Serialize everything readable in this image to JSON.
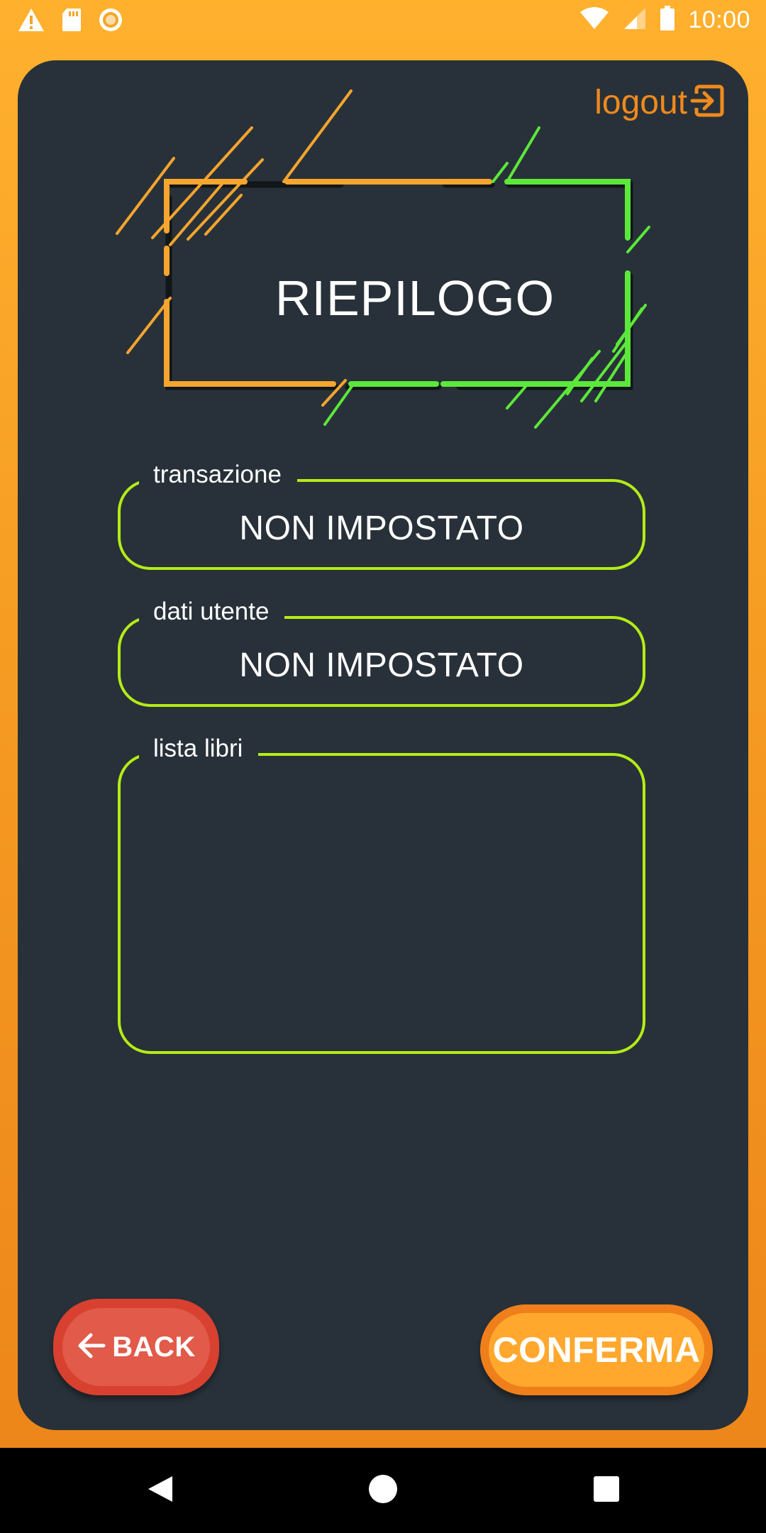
{
  "status_bar": {
    "time": "10:00",
    "icons": [
      "warning-icon",
      "sd-card-icon",
      "sync-icon",
      "wifi-icon",
      "signal-icon",
      "battery-icon"
    ]
  },
  "header": {
    "logout_label": "logout",
    "logout_icon": "logout-icon"
  },
  "title": "RIEPILOGO",
  "fields": {
    "transazione": {
      "label": "transazione",
      "value": "NON IMPOSTATO"
    },
    "dati_utente": {
      "label": "dati utente",
      "value": "NON IMPOSTATO"
    },
    "lista_libri": {
      "label": "lista libri",
      "value": ""
    }
  },
  "buttons": {
    "back_label": "BACK",
    "confirm_label": "CONFERMA"
  },
  "colors": {
    "background_top": "#ffb12e",
    "background_bottom": "#ec8419",
    "card": "#283139",
    "accent_orange": "#f08a1c",
    "accent_lime": "#b4ec16",
    "accent_green": "#5ce83a",
    "back_red": "#d84030",
    "confirm_orange": "#ffa82d"
  }
}
